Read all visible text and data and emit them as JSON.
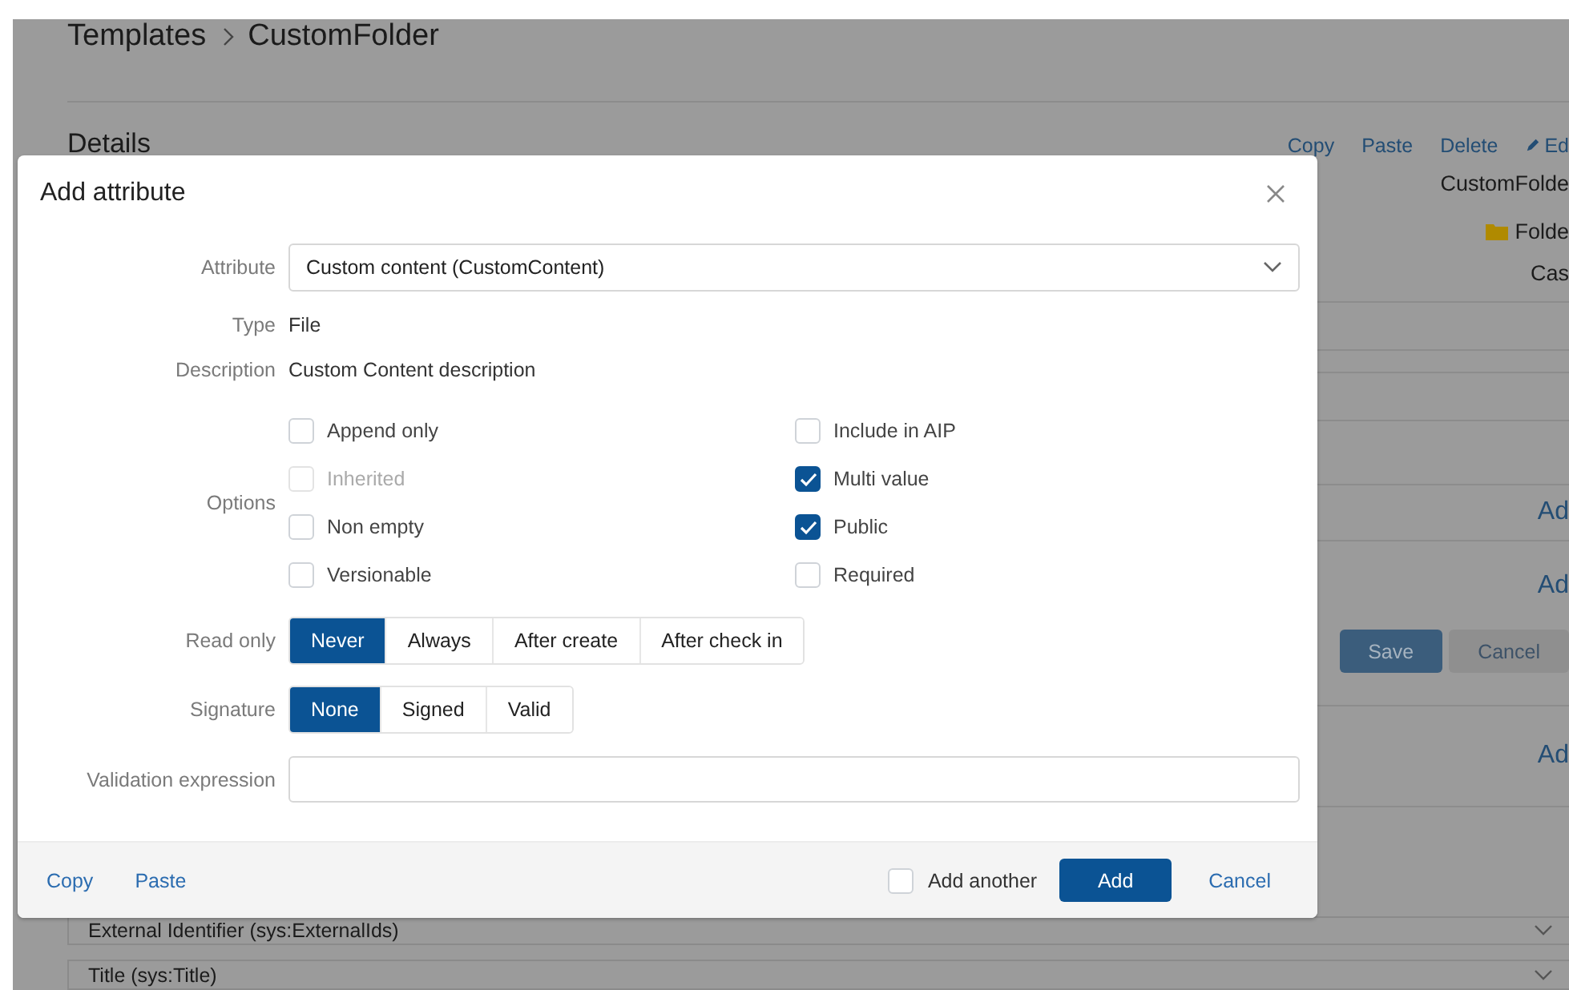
{
  "page": {
    "breadcrumb": [
      "Templates",
      "CustomFolder"
    ],
    "section_title": "Details",
    "actions": [
      {
        "label": "Copy",
        "kind": "link"
      },
      {
        "label": "Paste",
        "kind": "link"
      },
      {
        "label": "Delete",
        "kind": "link"
      },
      {
        "label": "Ed",
        "kind": "edit"
      }
    ],
    "properties": [
      {
        "value": "CustomFolde",
        "kind": "text"
      },
      {
        "value": "Folde",
        "kind": "folder"
      },
      {
        "value": "Cas",
        "kind": "text"
      }
    ],
    "add_links": [
      "Ad",
      "Ad",
      "Ad"
    ],
    "form_buttons": [
      {
        "label": "Save",
        "kind": "primary"
      },
      {
        "label": "Cancel",
        "kind": "secondary"
      }
    ],
    "list_rows": [
      "External Identifier (sys:ExternalIds)",
      "Title (sys:Title)"
    ]
  },
  "dialog": {
    "title": "Add attribute",
    "attribute": {
      "label": "Attribute",
      "value": "Custom content (CustomContent)"
    },
    "type": {
      "label": "Type",
      "value": "File"
    },
    "description": {
      "label": "Description",
      "value": "Custom Content description"
    },
    "options_label": "Options",
    "options": [
      {
        "label": "Append only",
        "checked": false,
        "disabled": false
      },
      {
        "label": "Include in AIP",
        "checked": false,
        "disabled": false
      },
      {
        "label": "Inherited",
        "checked": false,
        "disabled": true
      },
      {
        "label": "Multi value",
        "checked": true,
        "disabled": false
      },
      {
        "label": "Non empty",
        "checked": false,
        "disabled": false
      },
      {
        "label": "Public",
        "checked": true,
        "disabled": false
      },
      {
        "label": "Versionable",
        "checked": false,
        "disabled": false
      },
      {
        "label": "Required",
        "checked": false,
        "disabled": false
      }
    ],
    "read_only": {
      "label": "Read only",
      "choices": [
        {
          "label": "Never",
          "selected": true
        },
        {
          "label": "Always",
          "selected": false
        },
        {
          "label": "After create",
          "selected": false
        },
        {
          "label": "After check in",
          "selected": false
        }
      ]
    },
    "signature": {
      "label": "Signature",
      "choices": [
        {
          "label": "None",
          "selected": true
        },
        {
          "label": "Signed",
          "selected": false
        },
        {
          "label": "Valid",
          "selected": false
        }
      ]
    },
    "validation": {
      "label": "Validation expression"
    },
    "footer": {
      "links": [
        "Copy",
        "Paste"
      ],
      "add_another": {
        "label": "Add another",
        "checked": false
      },
      "add_button": "Add",
      "cancel": "Cancel"
    }
  }
}
